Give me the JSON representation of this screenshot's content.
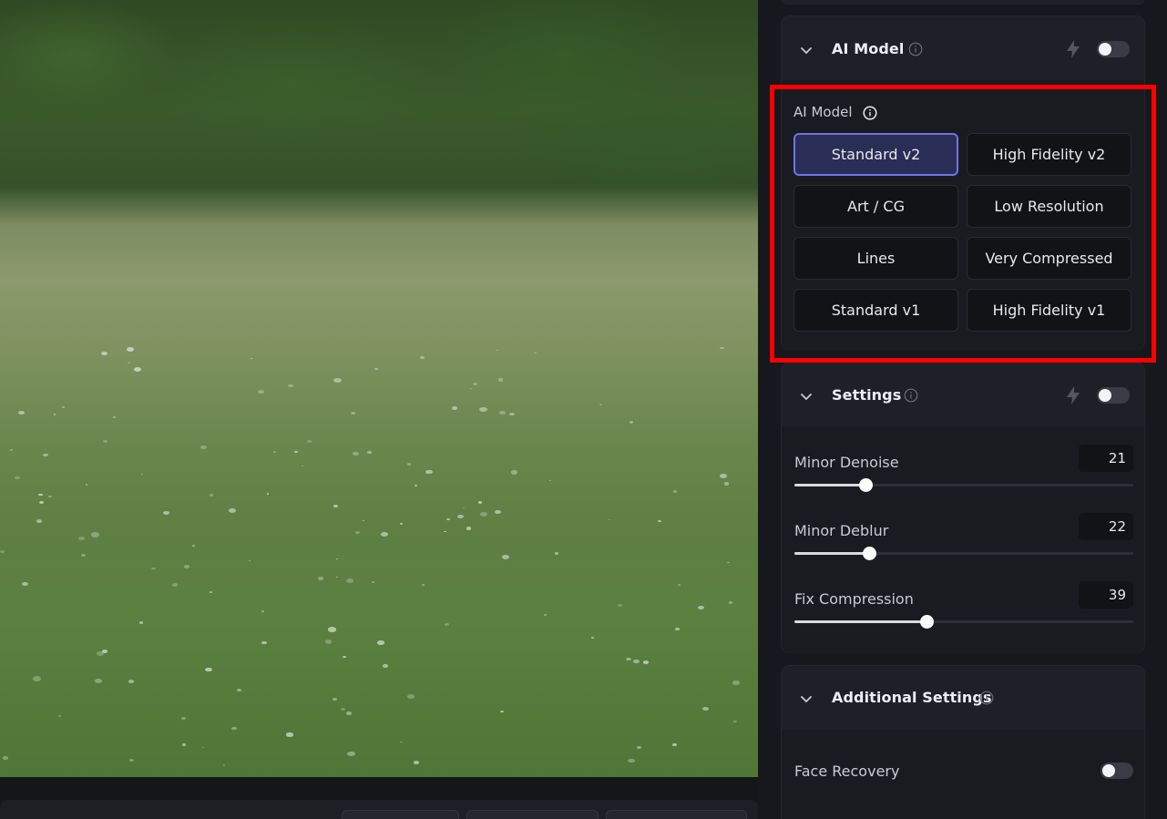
{
  "ai_model_card": {
    "title": "AI Model",
    "section_label": "AI Model",
    "enabled": false,
    "models": [
      {
        "label": "Standard v2",
        "selected": true
      },
      {
        "label": "High Fidelity v2",
        "selected": false
      },
      {
        "label": "Art / CG",
        "selected": false
      },
      {
        "label": "Low Resolution",
        "selected": false
      },
      {
        "label": "Lines",
        "selected": false
      },
      {
        "label": "Very Compressed",
        "selected": false
      },
      {
        "label": "Standard v1",
        "selected": false
      },
      {
        "label": "High Fidelity v1",
        "selected": false
      }
    ]
  },
  "settings_card": {
    "title": "Settings",
    "enabled": false,
    "sliders": [
      {
        "label": "Minor Denoise",
        "value": "21",
        "fraction": 0.21
      },
      {
        "label": "Minor Deblur",
        "value": "22",
        "fraction": 0.22
      },
      {
        "label": "Fix Compression",
        "value": "39",
        "fraction": 0.39
      }
    ]
  },
  "additional_card": {
    "title": "Additional Settings",
    "face_recovery_label": "Face Recovery",
    "face_recovery_enabled": false
  },
  "colors": {
    "accent": "#6f74e6",
    "highlight": "#ff0000"
  }
}
